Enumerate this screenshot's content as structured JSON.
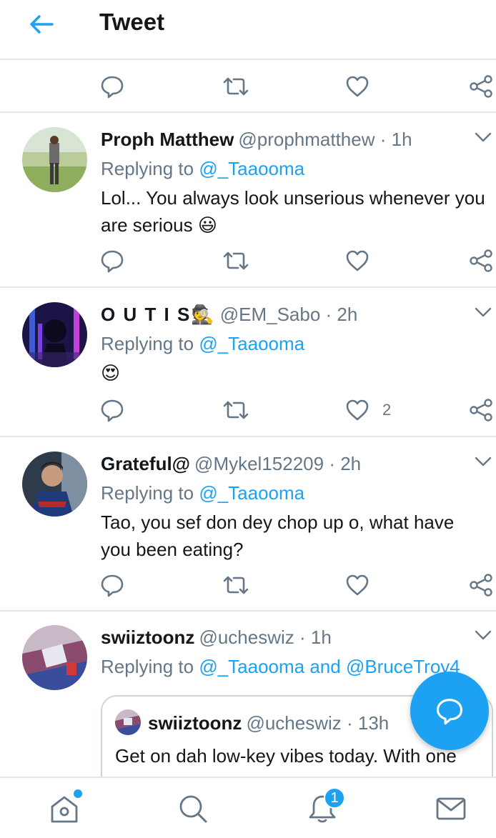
{
  "header": {
    "title": "Tweet"
  },
  "icons": {
    "back": "arrow-left-icon",
    "reply": "speech-bubble-icon",
    "retweet": "retweet-icon",
    "like": "heart-icon",
    "share": "share-icon",
    "more": "chevron-down-icon",
    "compose": "compose-reply-icon",
    "home": "home-icon",
    "search": "search-icon",
    "notifications": "bell-icon",
    "messages": "envelope-icon"
  },
  "colors": {
    "accent": "#1da1f2",
    "text": "#14171a",
    "muted": "#657786",
    "border": "#e1e8ed"
  },
  "tweets": [
    {
      "name": "Proph Matthew",
      "handle": "@prophmatthew",
      "time": "· 1h",
      "replying_label": "Replying to",
      "mentions": "@_Taaooma",
      "text": "Lol... You always look unserious whenever you are serious 😃",
      "likes": ""
    },
    {
      "name": "O U T I S🕵",
      "handle": "@EM_Sabo",
      "time": "· 2h",
      "replying_label": "Replying to",
      "mentions": "@_Taaooma",
      "text": "😍",
      "likes": "2"
    },
    {
      "name": "Grateful@",
      "handle": "@Mykel152209",
      "time": "· 2h",
      "replying_label": "Replying to",
      "mentions": "@_Taaooma",
      "text": "Tao, you sef don dey chop up o, what have you been eating?",
      "likes": ""
    },
    {
      "name": "swiiztoonz",
      "handle": "@ucheswiz",
      "time": "· 1h",
      "replying_label": "Replying to",
      "mentions": "@_Taaooma and @BruceTroy4",
      "text": "",
      "likes": ""
    }
  ],
  "quoted": {
    "name": "swiiztoonz",
    "handle": "@ucheswiz",
    "time": "· 13h",
    "text": "Get on dah low-key vibes today. With one"
  },
  "nav": {
    "notifications_badge": "1"
  }
}
